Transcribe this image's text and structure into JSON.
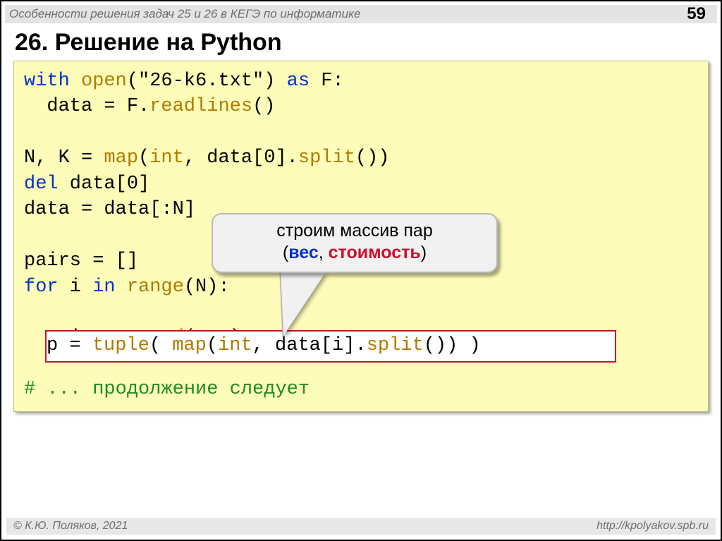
{
  "header": {
    "title": "Особенности решения задач 25 и 26 в КЕГЭ по информатике",
    "page": "59"
  },
  "title": "26. Решение на Python",
  "code": {
    "l1a": "with",
    "l1b": "open",
    "l1c": "(\"26-k6.txt\")",
    "l1d": "as",
    "l1e": "F:",
    "l2a": "  data = F.",
    "l2b": "readlines",
    "l2c": "()",
    "l3": " ",
    "l4a": "N, K = ",
    "l4b": "map",
    "l4c": "(",
    "l4d": "int",
    "l4e": ", data[",
    "l4f": "0",
    "l4g": "].",
    "l4h": "split",
    "l4i": "())",
    "l5a": "del",
    "l5b": " data[",
    "l5c": "0",
    "l5d": "]",
    "l6": "data = data[:N]",
    "l7": " ",
    "l8": "pairs = []",
    "l9a": "for",
    "l9b": " i ",
    "l9c": "in",
    "l9d": " ",
    "l9e": "range",
    "l9f": "(N):",
    "l10pad": " ",
    "l11a": "  pairs.",
    "l11b": "append",
    "l11c": "( p )",
    "l12": " ",
    "l13": "# ... продолжение следует"
  },
  "highlight": {
    "a": "p = ",
    "b": "tuple",
    "c": "( ",
    "d": "map",
    "e": "(",
    "f": "int",
    "g": ", data[i].",
    "h": "split",
    "i": "()) )"
  },
  "callout": {
    "t1": "строим массив пар",
    "t2a": "(",
    "t2b": "вес",
    "t2c": ", ",
    "t2d": "стоимость",
    "t2e": ")"
  },
  "footer": {
    "left": "© К.Ю. Поляков, 2021",
    "right": "http://kpolyakov.spb.ru"
  }
}
